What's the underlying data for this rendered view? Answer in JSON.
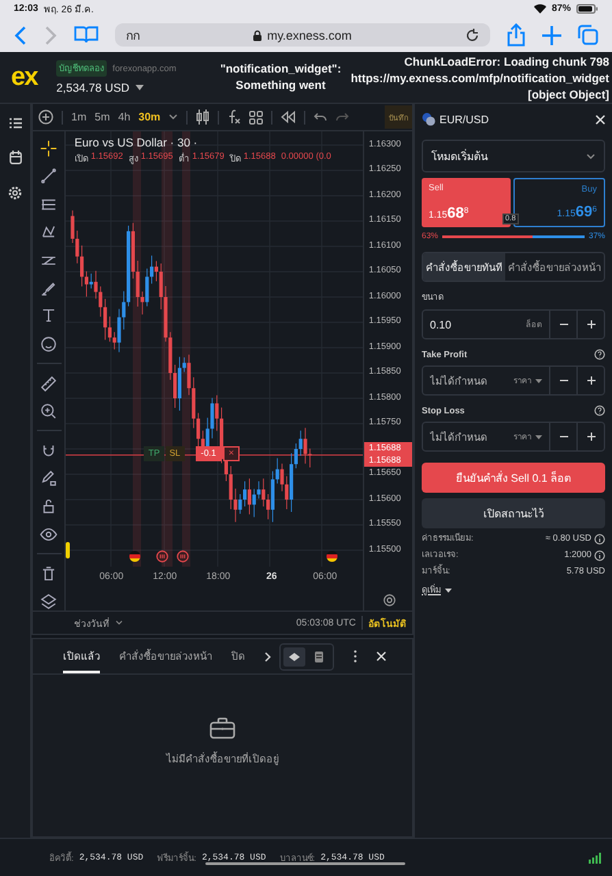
{
  "device_status": {
    "time": "12:03",
    "date": "พฤ. 26 มี.ค.",
    "battery": "87%"
  },
  "browser": {
    "text_size": "กก",
    "url": "my.exness.com"
  },
  "header": {
    "logo": "ex",
    "account_type": "บัญชีทดลอง",
    "domain": "forexonapp.com",
    "balance": "2,534.78 USD",
    "errors": [
      {
        "kind": "center",
        "lines": [
          "\"notification_widget\":",
          "Something went"
        ]
      },
      {
        "kind": "right",
        "lines": [
          "ChunkLoadError: Loading chunk 798",
          "https://my.exness.com/mfp/notification_widget",
          "[object Object]"
        ]
      }
    ]
  },
  "chart_toolbar": {
    "timeframes": [
      {
        "label": "1m",
        "selected": false
      },
      {
        "label": "5m",
        "selected": false
      },
      {
        "label": "4h",
        "selected": false
      },
      {
        "label": "30m",
        "selected": true
      }
    ],
    "save": "บันทึก"
  },
  "drawing_tools": [
    {
      "kind": "crosshair",
      "selected": true
    },
    {
      "kind": "line",
      "selected": false
    },
    {
      "kind": "lines",
      "selected": false
    },
    {
      "kind": "pattern",
      "selected": false
    },
    {
      "kind": "channel",
      "selected": false
    },
    {
      "kind": "brush",
      "selected": false
    },
    {
      "kind": "text",
      "selected": false
    },
    {
      "kind": "smile",
      "selected": false
    },
    {
      "kind": "ruler",
      "selected": false
    },
    {
      "kind": "zoom",
      "selected": false
    },
    {
      "kind": "magnet",
      "selected": false
    },
    {
      "kind": "pencil",
      "selected": false
    },
    {
      "kind": "lock",
      "selected": false
    },
    {
      "kind": "eye",
      "selected": false
    },
    {
      "kind": "trash",
      "selected": false
    },
    {
      "kind": "layers",
      "selected": false
    }
  ],
  "chart": {
    "title": "Euro vs US Dollar · 30 ·",
    "ohlc": [
      {
        "label": "เปิด",
        "value": "1.15692"
      },
      {
        "label": "สูง",
        "value": "1.15695"
      },
      {
        "label": "ต่ำ",
        "value": "1.15679"
      },
      {
        "label": "ปิด",
        "value": "1.15688"
      }
    ],
    "change": "0.00000 (0.0",
    "price_ticks": [
      "1.16300",
      "1.16250",
      "1.16200",
      "1.16150",
      "1.16100",
      "1.16050",
      "1.16000",
      "1.15950",
      "1.15900",
      "1.15850",
      "1.15800",
      "1.15750",
      "1.15650",
      "1.15600",
      "1.15550",
      "1.15500"
    ],
    "current_price": [
      "1.15688",
      "1.15688"
    ],
    "time_ticks": [
      {
        "label": "06:00",
        "bold": false
      },
      {
        "label": "12:00",
        "bold": false
      },
      {
        "label": "18:00",
        "bold": false
      },
      {
        "label": "26",
        "bold": true
      },
      {
        "label": "06:00",
        "bold": false
      }
    ],
    "position": {
      "tp": "TP",
      "sl": "SL",
      "volume": "-0.1",
      "close": "×"
    },
    "date_range": "ช่วงวันที่",
    "clock": "05:03:08 UTC",
    "auto": "อัตโนมัติ"
  },
  "positions": {
    "tabs": [
      {
        "label": "เปิดแล้ว",
        "selected": true
      },
      {
        "label": "คำสั่งซื้อขายล่วงหน้า",
        "selected": false
      },
      {
        "label": "ปิด",
        "selected": false
      }
    ],
    "views": [
      {
        "kind": "grouped",
        "selected": true
      },
      {
        "kind": "list",
        "selected": false
      }
    ],
    "empty": "ไม่มีคำสั่งซื้อขายที่เปิดอยู่"
  },
  "account_summary": [
    {
      "label": "อิควิตี้:",
      "value": "2,534.78 USD"
    },
    {
      "label": "ฟรีมาร์จิ้น:",
      "value": "2,534.78 USD"
    },
    {
      "label": "บาลานซ์:",
      "value": "2,534.78 USD"
    }
  ],
  "order": {
    "symbol": "EUR/USD",
    "mode": "โหมดเริ่มต้น",
    "sell": {
      "label": "Sell",
      "base": "1.15",
      "pips": "68",
      "fraction": "8"
    },
    "buy": {
      "label": "Buy",
      "base": "1.15",
      "pips": "69",
      "fraction": "6"
    },
    "spread": "0.8",
    "sentiment": {
      "sell": "63%",
      "buy": "37%",
      "level": 0.63
    },
    "tabs": [
      {
        "label": "คำสั่งซื้อขายทันที",
        "selected": true
      },
      {
        "label": "คำสั่งซื้อขายล่วงหน้า",
        "selected": false
      }
    ],
    "volume": {
      "label": "ขนาด",
      "value": "0.10",
      "unit": "ล็อต"
    },
    "take_profit": {
      "label": "Take Profit",
      "placeholder": "ไม่ได้กำหนด",
      "unit": "ราคา"
    },
    "stop_loss": {
      "label": "Stop Loss",
      "placeholder": "ไม่ได้กำหนด",
      "unit": "ราคา"
    },
    "confirm": "ยืนยันคำสั่ง Sell 0.1 ล็อต",
    "hold": "เปิดสถานะไว้",
    "details": [
      {
        "label": "ค่าธรรมเนียม:",
        "value": "≈ 0.80 USD",
        "info": true
      },
      {
        "label": "เลเวอเรจ:",
        "value": "1:2000",
        "info": true
      },
      {
        "label": "มาร์จิ้น:",
        "value": "5.78 USD",
        "info": false
      }
    ],
    "more": "ดูเพิ่ม"
  }
}
